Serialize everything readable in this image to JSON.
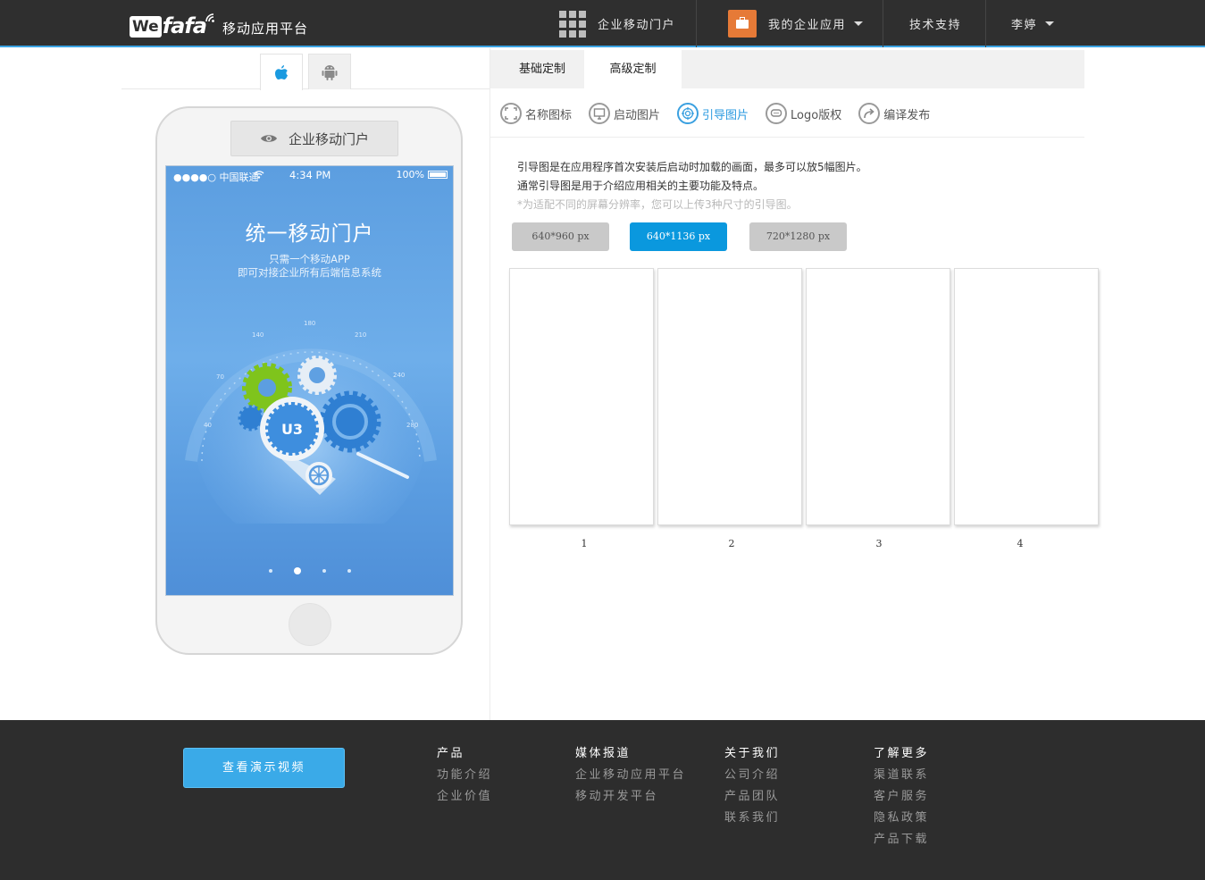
{
  "brand": {
    "logo_we": "We",
    "logo_fafa": "fafa",
    "subtitle": "移动应用平台"
  },
  "topnav": {
    "portal": "企业移动门户",
    "my_apps": "我的企业应用",
    "support": "技术支持",
    "user": "李婷"
  },
  "phone": {
    "preview_label": "企业移动门户",
    "status": {
      "carrier": "●●●●○ 中国联通",
      "time": "4:34 PM",
      "battery": "100%"
    },
    "screen_title": "统一移动门户",
    "screen_sub1": "只需一个移动APP",
    "screen_sub2": "即可对接企业所有后端信息系统",
    "gauge_ticks": [
      "40",
      "70",
      "140",
      "180",
      "210",
      "240",
      "280"
    ]
  },
  "config_tabs": [
    "基础定制",
    "高级定制"
  ],
  "subnav": [
    "名称图标",
    "启动图片",
    "引导图片",
    "Logo版权",
    "编译发布"
  ],
  "description": {
    "line1": "引导图是在应用程序首次安装后启动时加载的画面，最多可以放5幅图片。",
    "line2": "通常引导图是用于介绍应用相关的主要功能及特点。",
    "note": "*为适配不同的屏幕分辨率，您可以上传3种尺寸的引导图。"
  },
  "sizes": [
    "640*960 px",
    "640*1136 px",
    "720*1280 px"
  ],
  "slots": [
    "1",
    "2",
    "3",
    "4"
  ],
  "footer": {
    "demo_button": "查看演示视频",
    "columns": [
      {
        "title": "产品",
        "links": [
          "功能介绍",
          "企业价值"
        ]
      },
      {
        "title": "媒体报道",
        "links": [
          "企业移动应用平台",
          "移动开发平台"
        ]
      },
      {
        "title": "关于我们",
        "links": [
          "公司介绍",
          "产品团队",
          "联系我们"
        ]
      },
      {
        "title": "了解更多",
        "links": [
          "渠道联系",
          "客户服务",
          "隐私政策",
          "产品下载"
        ]
      }
    ]
  },
  "colors": {
    "accent": "#0a98de",
    "topbar": "#2f2f2f",
    "footer": "#2d2d2d",
    "briefcase": "#e67a37"
  }
}
